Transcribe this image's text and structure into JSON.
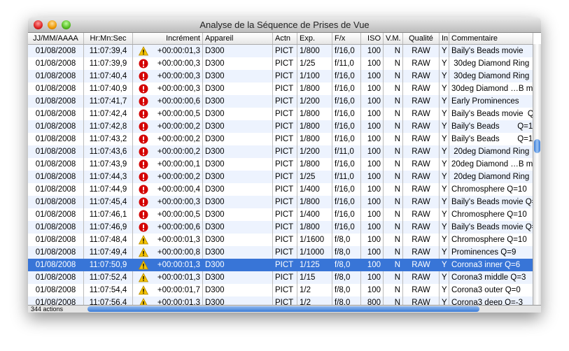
{
  "window": {
    "title": "Analyse de la Séquence de Prises de Vue",
    "status": "344 actions"
  },
  "columns": [
    "JJ/MM/AAAA",
    "Hr:Mn:Sec",
    "Incrément",
    "Appareil",
    "Actn",
    "Exp.",
    "F/x",
    "ISO",
    "V.M.",
    "Qualité",
    "In",
    "Commentaire"
  ],
  "colors": {
    "selection": "#3875d7",
    "alt_row": "#edf3fe",
    "warning": "#f5c400",
    "error": "#d40000"
  },
  "rows": [
    [
      "01/08/2008",
      "11:07:39,4",
      "warning",
      "+00:00:01,3",
      "D300",
      "PICT",
      "1/800",
      "f/16,0",
      "100",
      "N",
      "RAW",
      "Y",
      "Baily's Beads movie"
    ],
    [
      "01/08/2008",
      "11:07:39,9",
      "error",
      "+00:00:00,3",
      "D300",
      "PICT",
      "1/25",
      "f/11,0",
      "100",
      "N",
      "RAW",
      "Y",
      " 30deg Diamond Ring"
    ],
    [
      "01/08/2008",
      "11:07:40,4",
      "error",
      "+00:00:00,3",
      "D300",
      "PICT",
      "1/100",
      "f/16,0",
      "100",
      "N",
      "RAW",
      "Y",
      " 30deg Diamond Ring"
    ],
    [
      "01/08/2008",
      "11:07:40,9",
      "error",
      "+00:00:00,3",
      "D300",
      "PICT",
      "1/800",
      "f/16,0",
      "100",
      "N",
      "RAW",
      "Y",
      "30deg Diamond …B m"
    ],
    [
      "01/08/2008",
      "11:07:41,7",
      "error",
      "+00:00:00,6",
      "D300",
      "PICT",
      "1/200",
      "f/16,0",
      "100",
      "N",
      "RAW",
      "Y",
      "Early Prominences"
    ],
    [
      "01/08/2008",
      "11:07:42,4",
      "error",
      "+00:00:00,5",
      "D300",
      "PICT",
      "1/800",
      "f/16,0",
      "100",
      "N",
      "RAW",
      "Y",
      "Baily's Beads movie  Q"
    ],
    [
      "01/08/2008",
      "11:07:42,8",
      "error",
      "+00:00:00,2",
      "D300",
      "PICT",
      "1/800",
      "f/16,0",
      "100",
      "N",
      "RAW",
      "Y",
      "Baily's Beads        Q=1"
    ],
    [
      "01/08/2008",
      "11:07:43,2",
      "error",
      "+00:00:00,2",
      "D300",
      "PICT",
      "1/800",
      "f/16,0",
      "100",
      "N",
      "RAW",
      "Y",
      "Baily's Beads        Q=1"
    ],
    [
      "01/08/2008",
      "11:07:43,6",
      "error",
      "+00:00:00,2",
      "D300",
      "PICT",
      "1/200",
      "f/11,0",
      "100",
      "N",
      "RAW",
      "Y",
      " 20deg Diamond Ring"
    ],
    [
      "01/08/2008",
      "11:07:43,9",
      "error",
      "+00:00:00,1",
      "D300",
      "PICT",
      "1/800",
      "f/16,0",
      "100",
      "N",
      "RAW",
      "Y",
      "20deg Diamond …B m"
    ],
    [
      "01/08/2008",
      "11:07:44,3",
      "error",
      "+00:00:00,2",
      "D300",
      "PICT",
      "1/25",
      "f/11,0",
      "100",
      "N",
      "RAW",
      "Y",
      " 20deg Diamond Ring"
    ],
    [
      "01/08/2008",
      "11:07:44,9",
      "error",
      "+00:00:00,4",
      "D300",
      "PICT",
      "1/400",
      "f/16,0",
      "100",
      "N",
      "RAW",
      "Y",
      "Chromosphere Q=10"
    ],
    [
      "01/08/2008",
      "11:07:45,4",
      "error",
      "+00:00:00,3",
      "D300",
      "PICT",
      "1/800",
      "f/16,0",
      "100",
      "N",
      "RAW",
      "Y",
      "Baily's Beads movie Q="
    ],
    [
      "01/08/2008",
      "11:07:46,1",
      "error",
      "+00:00:00,5",
      "D300",
      "PICT",
      "1/400",
      "f/16,0",
      "100",
      "N",
      "RAW",
      "Y",
      "Chromosphere Q=10"
    ],
    [
      "01/08/2008",
      "11:07:46,9",
      "error",
      "+00:00:00,6",
      "D300",
      "PICT",
      "1/800",
      "f/16,0",
      "100",
      "N",
      "RAW",
      "Y",
      "Baily's Beads movie Q="
    ],
    [
      "01/08/2008",
      "11:07:48,4",
      "warning",
      "+00:00:01,3",
      "D300",
      "PICT",
      "1/1600",
      "f/8,0",
      "100",
      "N",
      "RAW",
      "Y",
      "Chromosphere Q=10"
    ],
    [
      "01/08/2008",
      "11:07:49,4",
      "warning",
      "+00:00:00,8",
      "D300",
      "PICT",
      "1/1000",
      "f/8,0",
      "100",
      "N",
      "RAW",
      "Y",
      "Prominences Q=9"
    ],
    [
      "01/08/2008",
      "11:07:50,9",
      "warning",
      "+00:00:01,3",
      "D300",
      "PICT",
      "1/125",
      "f/8,0",
      "100",
      "N",
      "RAW",
      "Y",
      "Corona3 inner Q=6"
    ],
    [
      "01/08/2008",
      "11:07:52,4",
      "warning",
      "+00:00:01,3",
      "D300",
      "PICT",
      "1/15",
      "f/8,0",
      "100",
      "N",
      "RAW",
      "Y",
      "Corona3 middle Q=3"
    ],
    [
      "01/08/2008",
      "11:07:54,4",
      "warning",
      "+00:00:01,7",
      "D300",
      "PICT",
      "1/2",
      "f/8,0",
      "100",
      "N",
      "RAW",
      "Y",
      "Corona3 outer Q=0"
    ],
    [
      "01/08/2008",
      "11:07:56,4",
      "warning",
      "+00:00:01,3",
      "D300",
      "PICT",
      "1/2",
      "f/8,0",
      "800",
      "N",
      "RAW",
      "Y",
      "Corona3 deep Q=-3"
    ]
  ],
  "selected_row": 17
}
